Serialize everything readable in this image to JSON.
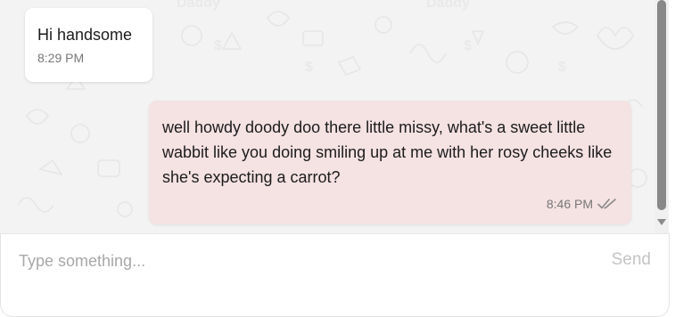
{
  "messages": [
    {
      "direction": "incoming",
      "text": "Hi handsome",
      "time": "8:29 PM"
    },
    {
      "direction": "outgoing",
      "text": "well howdy doody doo there little missy, what's a sweet little wabbit like you doing smiling up at me with her rosy cheeks like she's expecting a carrot?",
      "time": "8:46 PM",
      "status_icon": "double-check-icon"
    }
  ],
  "composer": {
    "placeholder": "Type something...",
    "value": "",
    "send_label": "Send"
  },
  "colors": {
    "chat_background": "#f3f3f3",
    "incoming_bubble": "#ffffff",
    "outgoing_bubble": "#f5e2e3",
    "send_disabled": "#c4c4c4"
  }
}
